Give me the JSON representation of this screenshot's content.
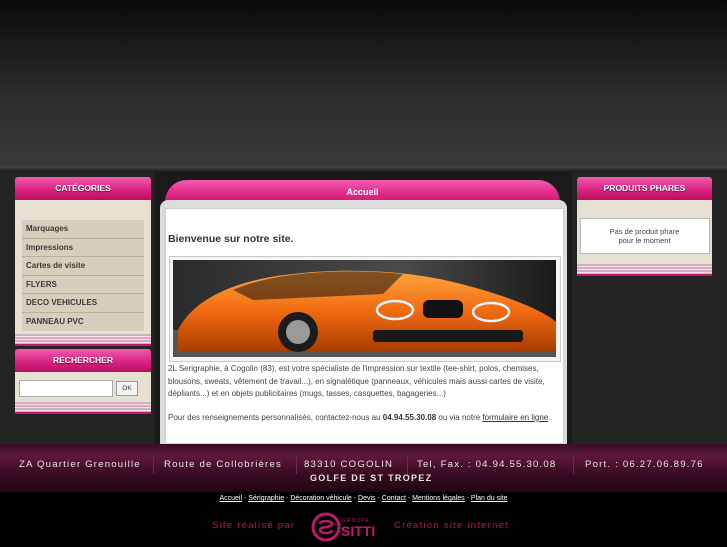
{
  "categories": {
    "title": "CATÉGORIES",
    "items": [
      {
        "label": "Marquages"
      },
      {
        "label": "Impressions"
      },
      {
        "label": "Cartes de visite"
      },
      {
        "label": "FLYERS"
      },
      {
        "label": "DECO VEHICULES"
      },
      {
        "label": "PANNEAU PVC"
      }
    ]
  },
  "search": {
    "title": "RECHERCHER",
    "value": "",
    "placeholder": "",
    "button_label": "OK"
  },
  "products": {
    "title": "PRODUITS PHARES",
    "empty_line1": "Pas de produit phare",
    "empty_line2": "pour le moment"
  },
  "main": {
    "tab_label": "Accueil",
    "welcome": "Bienvenue sur notre site.",
    "para1": "2L Serigraphie, à Cogolin (83), est votre spécialiste de l'impression sur textile (tee-shirt, polos, chemises, blousons, sweats, vêtement de travail...), en signalétique (panneaux, véhicules mais aussi cartes de visite, dépliants...) et en objets publicitaires (mugs, tasses, casquettes, bagageries...)",
    "para2_prefix": "Pour des renseignements personnalisés, contactez-nous au ",
    "phone": "04.94.55.30.08",
    "para2_mid": " ou via notre ",
    "form_link": "formulaire en ligne",
    "para2_suffix": "."
  },
  "footer": {
    "address": {
      "street": "ZA Quartier Grenouille",
      "road": "Route de Collobrières",
      "city": "83310 COGOLIN",
      "tel": "Tel, Fax. : 04.94.55.30.08",
      "port": "Port. : 06.27.06.89.76",
      "golfe": "GOLFE  DE ST TROPEZ"
    },
    "links": [
      {
        "label": "Accueil"
      },
      {
        "label": "Sérigraphie"
      },
      {
        "label": "Décoration véhicule"
      },
      {
        "label": "Devis"
      },
      {
        "label": "Contact"
      },
      {
        "label": "Mentions légales"
      },
      {
        "label": "Plan du site"
      }
    ],
    "credit_left": "Site réalisé par",
    "credit_right": "Création site internet",
    "logo_top": "GROUPE",
    "logo_text": "SITTI"
  },
  "colors": {
    "accent": "#d8207e",
    "dark": "#1a1a1a",
    "panel": "#e6e0d2"
  }
}
